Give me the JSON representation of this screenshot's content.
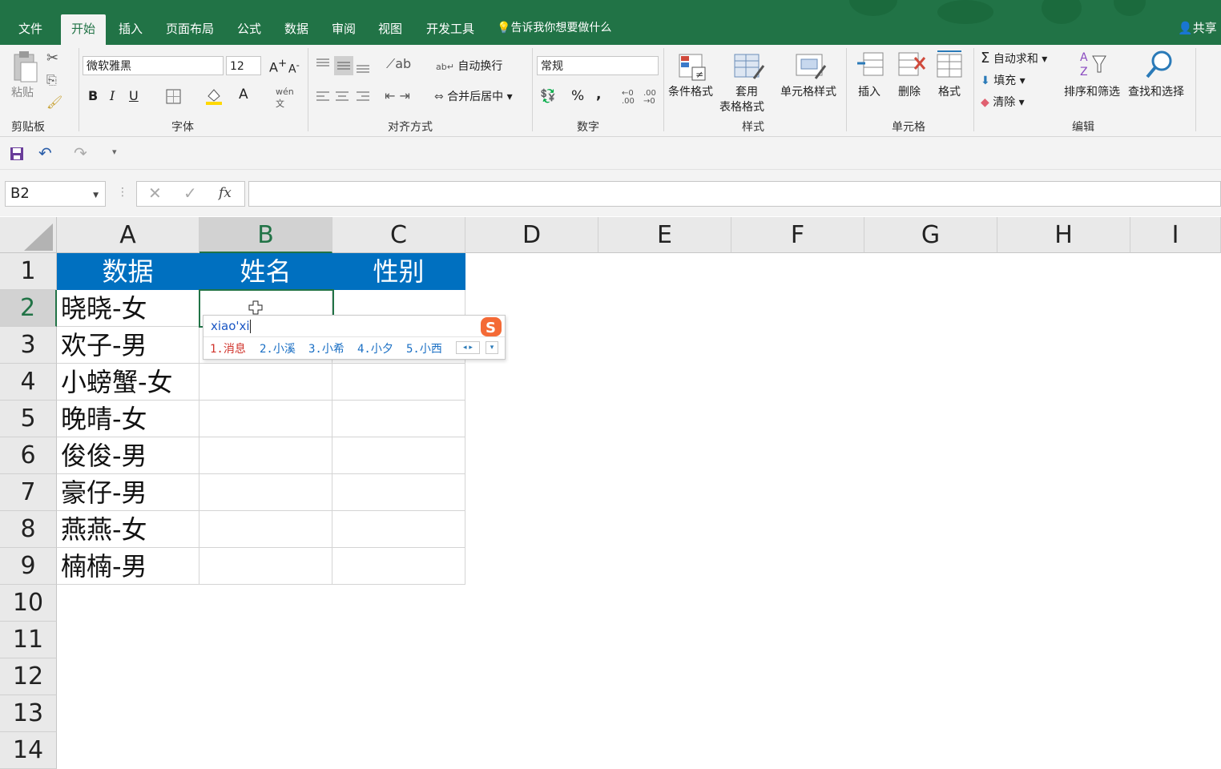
{
  "tabs": [
    "文件",
    "开始",
    "插入",
    "页面布局",
    "公式",
    "数据",
    "审阅",
    "视图",
    "开发工具"
  ],
  "active_tab": "开始",
  "tell_me": "告诉我你想要做什么",
  "share": "共享",
  "ribbon": {
    "clipboard": {
      "paste": "粘贴",
      "label": "剪贴板"
    },
    "font": {
      "name": "微软雅黑",
      "size": "12",
      "bold": "B",
      "italic": "I",
      "underline": "U",
      "label": "字体"
    },
    "alignment": {
      "wrap": "自动换行",
      "merge": "合并后居中",
      "label": "对齐方式"
    },
    "number": {
      "format": "常规",
      "percent": "%",
      "comma": ",",
      "label": "数字"
    },
    "styles": {
      "conditional": "条件格式",
      "table_line1": "套用",
      "table_line2": "表格格式",
      "cell_styles": "单元格样式",
      "label": "样式"
    },
    "cells": {
      "insert": "插入",
      "delete": "删除",
      "format": "格式",
      "label": "单元格"
    },
    "editing": {
      "autosum": "自动求和",
      "fill": "填充",
      "clear": "清除",
      "sort": "排序和筛选",
      "find": "查找和选择",
      "label": "编辑"
    }
  },
  "namebox": "B2",
  "fx": "fx",
  "columns": [
    "A",
    "B",
    "C",
    "D",
    "E",
    "F",
    "G",
    "H",
    "I"
  ],
  "selected_column": "B",
  "rows": [
    "1",
    "2",
    "3",
    "4",
    "5",
    "6",
    "7",
    "8",
    "9",
    "10",
    "11",
    "12",
    "13",
    "14"
  ],
  "selected_row": "2",
  "header_row": [
    "数据",
    "姓名",
    "性别"
  ],
  "data_rows": [
    [
      "晓晓-女",
      "",
      ""
    ],
    [
      "欢子-男",
      "",
      ""
    ],
    [
      "小螃蟹-女",
      "",
      ""
    ],
    [
      "晚晴-女",
      "",
      ""
    ],
    [
      "俊俊-男",
      "",
      ""
    ],
    [
      "豪仔-男",
      "",
      ""
    ],
    [
      "燕燕-女",
      "",
      ""
    ],
    [
      "楠楠-男",
      "",
      ""
    ]
  ],
  "ime": {
    "input": "xiao'xi",
    "candidates": [
      "1.消息",
      "2.小溪",
      "3.小希",
      "4.小夕",
      "5.小西"
    ]
  }
}
